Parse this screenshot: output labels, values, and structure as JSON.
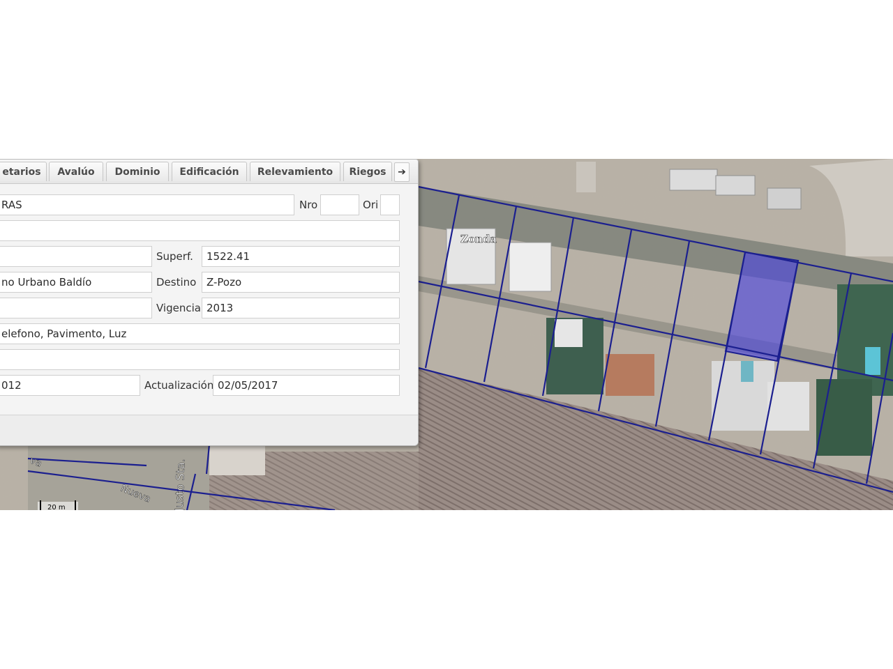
{
  "map": {
    "labels": {
      "zonda": "Zonda",
      "justo": "Justo Sta.",
      "nueva_1": "Nueva",
      "nueva_2": "va"
    },
    "scale": "20 m",
    "colors": {
      "parcel_line": "#1b1f8f",
      "selected_fill": "#4a44e0"
    }
  },
  "panel": {
    "tabs": [
      "etarios",
      "Avalúo",
      "Dominio",
      "Edificación",
      "Relevamiento",
      "Riegos"
    ],
    "tab_more_icon": "arrow-right-icon",
    "fields": {
      "calle": "RAS",
      "nro_label": "Nro",
      "nro_value": "",
      "ori_label": "Ori",
      "ori_value": "",
      "row2": "",
      "row3_left": "",
      "superf_label": "Superf.",
      "superf_value": "1522.41",
      "tipo_value": "no Urbano Baldío",
      "destino_label": "Destino",
      "destino_value": "Z-Pozo",
      "row5_left": "",
      "vigencia_label": "Vigencia",
      "vigencia_value": "2013",
      "servicios": "elefono, Pavimento, Luz",
      "row7": "",
      "fecha_left": "012",
      "actualizacion_label": "Actualización",
      "actualizacion_value": "02/05/2017"
    }
  }
}
